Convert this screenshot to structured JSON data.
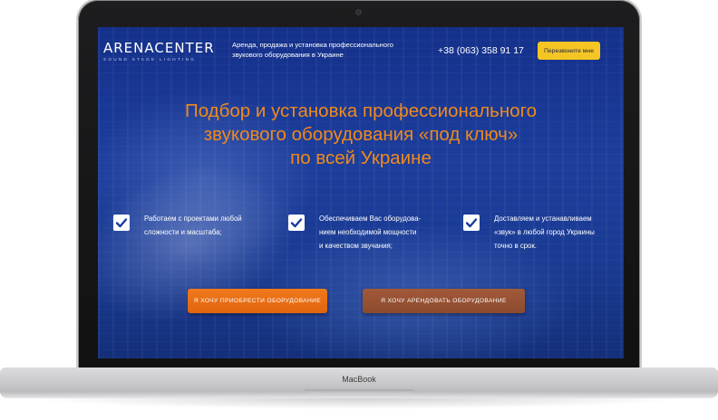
{
  "device": {
    "brand_label": "MacBook"
  },
  "header": {
    "logo_main": "ARENACENTER",
    "logo_sub": "SOUND STAGE LIGHTING",
    "tagline_line1": "Аренда, продажа и установка профессионального",
    "tagline_line2": "звукового оборудования в Украине",
    "phone": "+38 (063) 358 91 17",
    "callback_label": "Перезвоните мне",
    "callback_color": "#f5c623"
  },
  "hero": {
    "headline_line1": "Подбор и установка профессионального",
    "headline_line2": "звукового оборудования «под ключ»",
    "headline_line3": "по всей Украине",
    "accent_color": "#f08a1a"
  },
  "features": [
    {
      "icon": "checkbox-icon",
      "lines": [
        "Работаем с проектами любой",
        "сложности и масштаба;"
      ]
    },
    {
      "icon": "checkbox-icon",
      "lines": [
        "Обеспечиваем Вас оборудова-",
        "нием необходимой мощности",
        "и качеством звучания;"
      ]
    },
    {
      "icon": "checkbox-icon",
      "lines": [
        "Доставляем и устанавливаем",
        "«звук» в любой город Украины",
        "точно в срок."
      ]
    }
  ],
  "cta": {
    "buy_label": "Я ХОЧУ ПРИОБРЕСТИ ОБОРУДОВАНИЕ",
    "rent_label": "Я ХОЧУ АРЕНДОВАТЬ ОБОРУДОВАНИЕ",
    "buy_color": "#f07a1c",
    "rent_color": "#a15a3a"
  }
}
